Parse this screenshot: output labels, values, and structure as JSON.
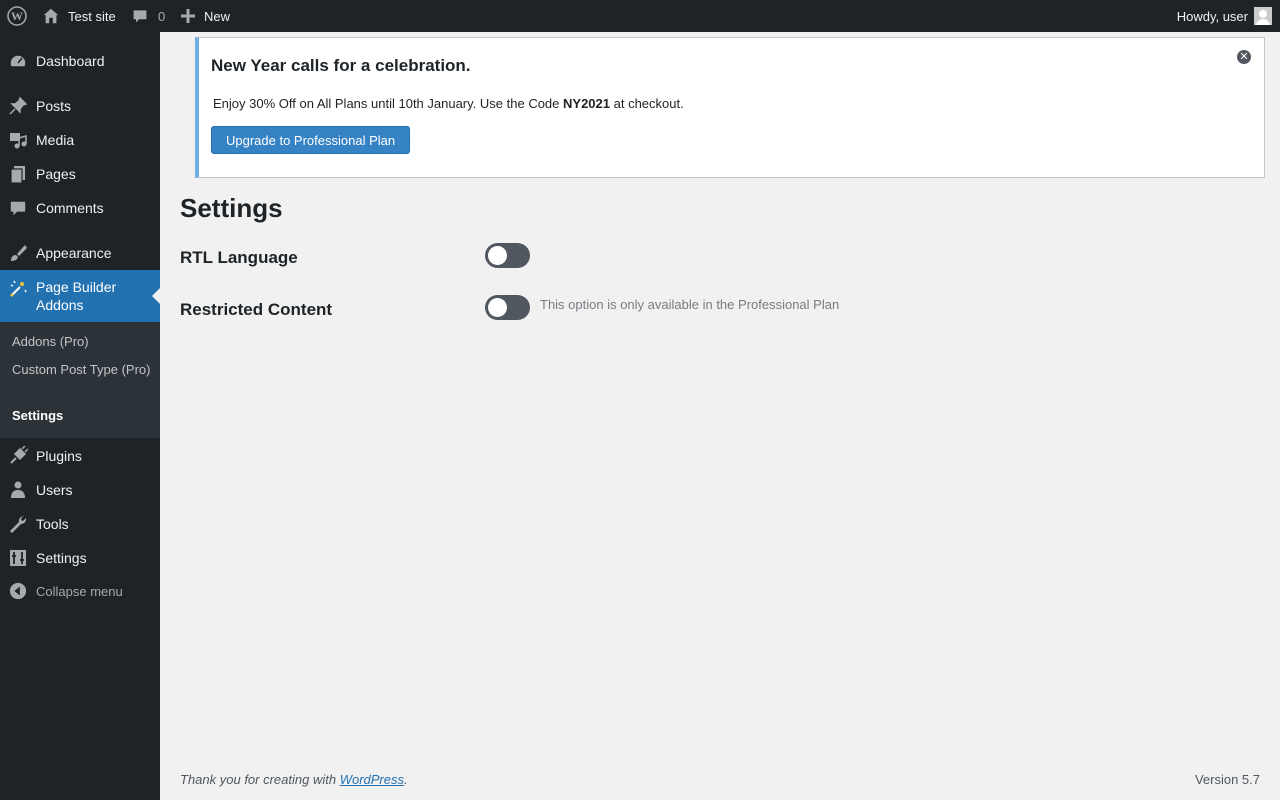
{
  "adminbar": {
    "site_name": "Test site",
    "comments_count": "0",
    "new_label": "New",
    "howdy": "Howdy, user"
  },
  "sidebar": {
    "items": [
      {
        "label": "Dashboard",
        "icon": "dashboard-icon"
      },
      {
        "label": "Posts",
        "icon": "pin-icon"
      },
      {
        "label": "Media",
        "icon": "media-icon"
      },
      {
        "label": "Pages",
        "icon": "pages-icon"
      },
      {
        "label": "Comments",
        "icon": "comment-icon"
      },
      {
        "label": "Appearance",
        "icon": "brush-icon"
      },
      {
        "label": "Page Builder Addons",
        "icon": "magic-wand-icon"
      },
      {
        "label": "Plugins",
        "icon": "plugin-icon"
      },
      {
        "label": "Users",
        "icon": "user-icon"
      },
      {
        "label": "Tools",
        "icon": "wrench-icon"
      },
      {
        "label": "Settings",
        "icon": "settings-icon"
      }
    ],
    "submenu": [
      "Addons (Pro)",
      "Custom Post Type (Pro)",
      "Settings"
    ],
    "collapse_label": "Collapse menu"
  },
  "notice": {
    "title": "New Year calls for a celebration.",
    "text_before": "Enjoy 30% Off on All Plans until 10th January. Use the Code ",
    "code": "NY2021",
    "text_after": " at checkout.",
    "button": "Upgrade to Professional Plan"
  },
  "main": {
    "title": "Settings",
    "options": [
      {
        "label": "RTL Language",
        "enabled": false,
        "note": ""
      },
      {
        "label": "Restricted Content",
        "enabled": false,
        "note": "This option is only available in the Professional Plan"
      }
    ]
  },
  "footer": {
    "thanks_prefix": "Thank you for creating with ",
    "link": "WordPress",
    "thanks_suffix": ".",
    "version": "Version 5.7"
  },
  "colors": {
    "admin_dark": "#1d2327",
    "accent": "#2271b1",
    "notice_border": "#72aee6"
  }
}
